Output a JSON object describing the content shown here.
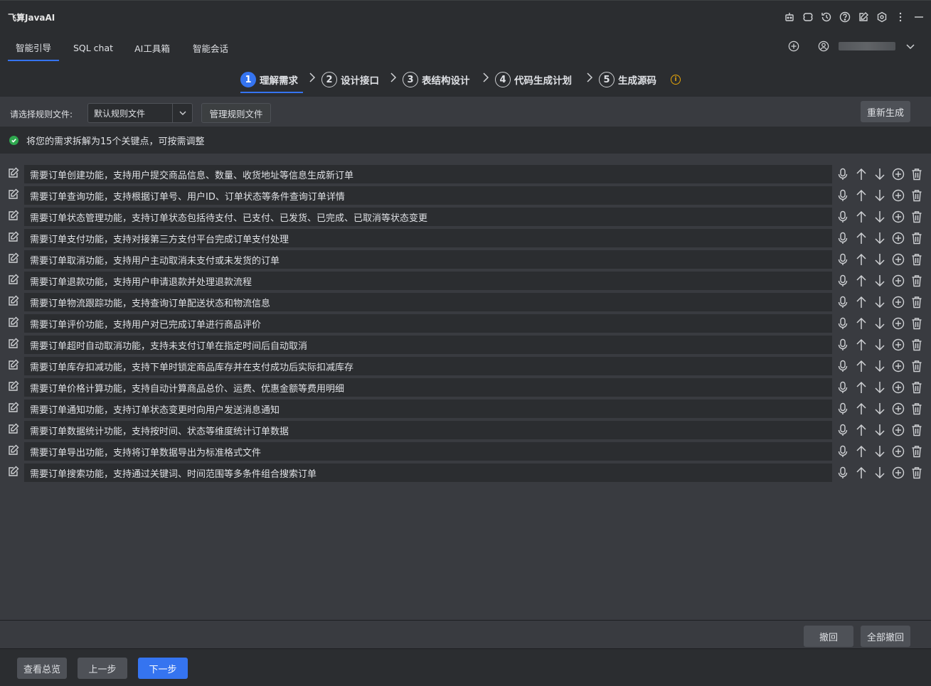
{
  "app": {
    "title": "飞算JavaAI"
  },
  "nav": {
    "tabs": [
      "智能引导",
      "SQL chat",
      "AI工具箱",
      "智能会话"
    ]
  },
  "steps": [
    {
      "num": "1",
      "label": "理解需求"
    },
    {
      "num": "2",
      "label": "设计接口"
    },
    {
      "num": "3",
      "label": "表结构设计"
    },
    {
      "num": "4",
      "label": "代码生成计划"
    },
    {
      "num": "5",
      "label": "生成源码"
    }
  ],
  "rules": {
    "label": "请选择规则文件:",
    "selected": "默认规则文件",
    "manage_button": "管理规则文件",
    "regenerate_button": "重新生成"
  },
  "info": {
    "message": "将您的需求拆解为15个关键点，可按需调整"
  },
  "requirements": [
    "需要订单创建功能，支持用户提交商品信息、数量、收货地址等信息生成新订单",
    "需要订单查询功能，支持根据订单号、用户ID、订单状态等条件查询订单详情",
    "需要订单状态管理功能，支持订单状态包括待支付、已支付、已发货、已完成、已取消等状态变更",
    "需要订单支付功能，支持对接第三方支付平台完成订单支付处理",
    "需要订单取消功能，支持用户主动取消未支付或未发货的订单",
    "需要订单退款功能，支持用户申请退款并处理退款流程",
    "需要订单物流跟踪功能，支持查询订单配送状态和物流信息",
    "需要订单评价功能，支持用户对已完成订单进行商品评价",
    "需要订单超时自动取消功能，支持未支付订单在指定时间后自动取消",
    "需要订单库存扣减功能，支持下单时锁定商品库存并在支付成功后实际扣减库存",
    "需要订单价格计算功能，支持自动计算商品总价、运费、优惠金额等费用明细",
    "需要订单通知功能，支持订单状态变更时向用户发送消息通知",
    "需要订单数据统计功能，支持按时间、状态等维度统计订单数据",
    "需要订单导出功能，支持将订单数据导出为标准格式文件",
    "需要订单搜索功能，支持通过关键词、时间范围等多条件组合搜索订单"
  ],
  "undo": {
    "undo_button": "撤回",
    "undo_all_button": "全部撤回"
  },
  "footer": {
    "overview_button": "查看总览",
    "prev_button": "上一步",
    "next_button": "下一步"
  },
  "colors": {
    "accent": "#3574f0",
    "success": "#2fa84f",
    "warning": "#e5a50a"
  }
}
